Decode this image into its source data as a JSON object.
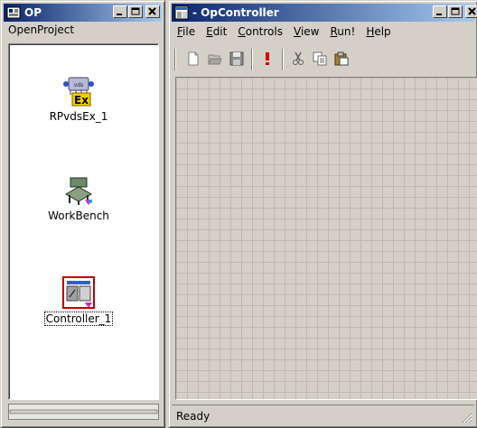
{
  "left_window": {
    "title": "OP",
    "project_label": "OpenProject",
    "items": [
      {
        "label": "RPvdsEx_1",
        "icon": "rpvdsex-icon"
      },
      {
        "label": "WorkBench",
        "icon": "workbench-icon"
      },
      {
        "label": "Controller_1",
        "icon": "controller-icon",
        "selected": true
      }
    ]
  },
  "right_window": {
    "title": "- OpController",
    "menus": [
      {
        "label": "File",
        "hotkey": "F",
        "rest": "ile"
      },
      {
        "label": "Edit",
        "hotkey": "E",
        "rest": "dit"
      },
      {
        "label": "Controls",
        "hotkey": "C",
        "rest": "ontrols"
      },
      {
        "label": "View",
        "hotkey": "V",
        "rest": "iew"
      },
      {
        "label": "Run!",
        "hotkey": "R",
        "rest": "un!"
      },
      {
        "label": "Help",
        "hotkey": "H",
        "rest": "elp"
      }
    ],
    "toolbar": [
      "new-icon",
      "open-icon",
      "save-icon",
      "run-icon",
      "cut-icon",
      "copy-icon",
      "paste-icon"
    ],
    "status": "Ready"
  },
  "colors": {
    "titlebar_start": "#0a246a",
    "titlebar_end": "#a6caf0",
    "face": "#d4d0c8",
    "run_red": "#d40000"
  }
}
